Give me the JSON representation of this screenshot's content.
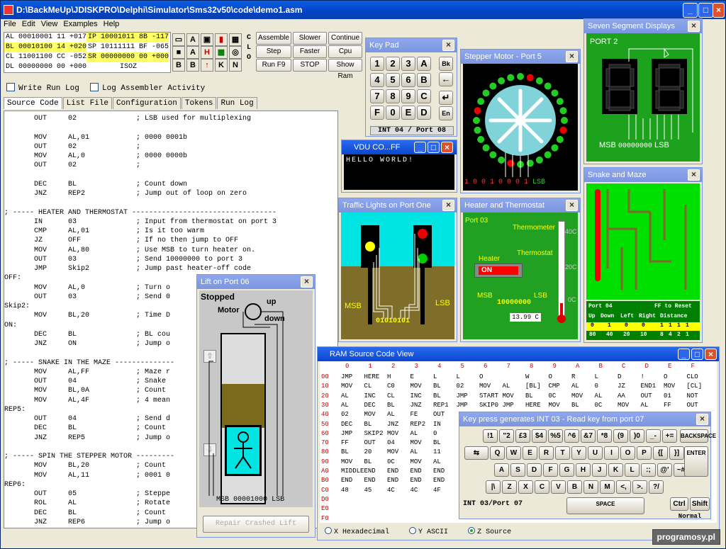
{
  "main": {
    "title": "D:\\BackMeUp\\JDISKPRO\\Delphi\\Simulator\\Sms32v50\\code\\demo1.asm"
  },
  "menu": [
    "File",
    "Edit",
    "View",
    "Examples",
    "Help"
  ],
  "registers": [
    [
      "AL 00010001 11 +017",
      "IP 10001011 8B -117"
    ],
    [
      "BL 00010100 14 +020",
      "SP 10111111 BF -065"
    ],
    [
      "CL 11001100 CC -052",
      "SR 00000000 00 +000"
    ],
    [
      "DL 00000000 00 +000",
      "ISOZ"
    ]
  ],
  "clo": [
    "C",
    "L",
    "O"
  ],
  "buttons": {
    "assemble": "Assemble",
    "slower": "Slower",
    "continue": "Continue",
    "step": "Step",
    "faster": "Faster",
    "cpu_reset": "Cpu Reset",
    "run": "Run F9",
    "stop": "STOP",
    "show_ram": "Show Ram"
  },
  "checks": {
    "write_log": "Write Run Log",
    "asm_log": "Log Assembler Activity"
  },
  "tabs": [
    "Source Code",
    "List File",
    "Configuration",
    "Tokens",
    "Run Log"
  ],
  "code": [
    "       OUT     02              ; LSB used for multiplexing",
    "",
    "       MOV     AL,01           ; 0000 0001b",
    "       OUT     02              ;",
    "       MOV     AL,0            ; 0000 0000b",
    "       OUT     02              ;",
    "",
    "       DEC     BL              ; Count down",
    "       JNZ     REP2            ; Jump out of loop on zero",
    "",
    "; ----- HEATER AND THERMOSTAT ----------------------------------",
    "       IN      03              ; Input from thermostat on port 3",
    "       CMP     AL,01           ; Is it too warm",
    "       JZ      OFF             ; If no then jump to OFF",
    "       MOV     AL,80           ; Use MSB to turn heater on.",
    "       OUT     03              ; Send 10000000 to port 3",
    "       JMP     Skip2           ; Jump past heater-off code",
    "OFF:",
    "       MOV     AL,0            ; Turn o",
    "       OUT     03              ; Send 0",
    "Skip2:",
    "       MOV     BL,20           ; Time D",
    "ON:",
    "       DEC     BL              ; BL cou",
    "       JNZ     ON              ; Jump o",
    "",
    "; ----- SNAKE IN THE MAZE --------------",
    "       MOV     AL,FF           ; Maze r",
    "       OUT     04              ; Snake",
    "       MOV     BL,0A           ; Count",
    "       MOV     AL,4F           ; 4 mean",
    "REP5:",
    "       OUT     04              ; Send d",
    "       DEC     BL              ; Count",
    "       JNZ     REP5            ; Jump o",
    "",
    "; ----- SPIN THE STEPPER MOTOR ---------",
    "       MOV     BL,20           ; Count",
    "       MOV     AL,11           ; 0001 0",
    "REP6:",
    "       OUT     05              ; Steppe",
    "       ROL     AL              ; Rotate",
    "       DEC     BL              ; Count",
    "       JNZ     REP6            ; Jump o"
  ],
  "keypad": {
    "title": "Key Pad",
    "keys": [
      "1",
      "2",
      "3",
      "A",
      "4",
      "5",
      "6",
      "B",
      "7",
      "8",
      "9",
      "C",
      "F",
      "0",
      "E",
      "D"
    ],
    "side": [
      "Bk",
      "←",
      "↵",
      "En"
    ],
    "footer": "INT 04 / Port 08"
  },
  "stepper": {
    "title": "Stepper Motor - Port 5",
    "bits": "1 0 0 1 0 0 0 1",
    "lsb": "LSB"
  },
  "sevenseg": {
    "title": "Seven Segment Displays",
    "port": "PORT  2",
    "msb": "MSB",
    "bits": "00000000",
    "lsb": "LSB"
  },
  "vdu": {
    "title": "VDU CO...FF",
    "text": "HELLO WORLD!"
  },
  "traffic": {
    "title": "Traffic Lights on Port One",
    "msb": "MSB",
    "lsb": "LSB",
    "bits": "01010101"
  },
  "heater": {
    "title": "Heater and Thermostat",
    "port": "Port 03",
    "thermometer": "Thermometer",
    "thermostat": "Thermostat",
    "heater": "Heater",
    "on": "ON",
    "msb": "MSB",
    "lsb": "LSB",
    "bits": "10000000",
    "temp": "13.99 C",
    "t40": "40C",
    "t20": "20C",
    "t0": "0C"
  },
  "snake": {
    "title": "Snake and Maze",
    "port": "Port 04",
    "reset": "FF to Reset",
    "headers": [
      "Up",
      "Down",
      "Left",
      "Right",
      "Distance"
    ],
    "bits": [
      "0",
      "1",
      "0",
      "0",
      "1",
      "1",
      "1",
      "1"
    ],
    "weights": [
      "80",
      "40",
      "20",
      "10",
      "8",
      "4",
      "2",
      "1"
    ]
  },
  "lift": {
    "title": "Lift on Port 06",
    "status": "Stopped",
    "motor": "Motor",
    "up": "up",
    "down": "down",
    "msb": "MSB",
    "bits": "00001000",
    "lsb": "LSB",
    "repair": "Repair Crashed Lift"
  },
  "ram": {
    "title": "RAM Source Code View",
    "cols": [
      "0",
      "1",
      "2",
      "3",
      "4",
      "5",
      "6",
      "7",
      "8",
      "9",
      "A",
      "B",
      "C",
      "D",
      "E",
      "F"
    ],
    "rows": [
      [
        "00",
        [
          "JMP",
          "HERE",
          "H",
          "E",
          "L",
          "L",
          "O",
          "",
          "W",
          "O",
          "R",
          "L",
          "D",
          "!",
          "O",
          "CLO"
        ]
      ],
      [
        "10",
        [
          "MOV",
          "CL",
          "C0",
          "MOV",
          "BL",
          "02",
          "MOV",
          "AL",
          "[BL]",
          "CMP",
          "AL",
          "0",
          "JZ",
          "END1",
          "MOV",
          "[CL]"
        ]
      ],
      [
        "20",
        [
          "AL",
          "INC",
          "CL",
          "INC",
          "BL",
          "JMP",
          "START",
          "MOV",
          "BL",
          "0C",
          "MOV",
          "AL",
          "AA",
          "OUT",
          "01",
          "NOT"
        ]
      ],
      [
        "30",
        [
          "AL",
          "DEC",
          "BL",
          "JNZ",
          "REP1",
          "JMP",
          "SKIP0",
          "JMP",
          "HERE",
          "MOV",
          "BL",
          "0C",
          "MOV",
          "AL",
          "FF",
          "OUT"
        ]
      ],
      [
        "40",
        [
          "02",
          "MOV",
          "AL",
          "FE",
          "OUT",
          "",
          "",
          "",
          "",
          "",
          "",
          "",
          "",
          "",
          "",
          ""
        ]
      ],
      [
        "50",
        [
          "DEC",
          "BL",
          "JNZ",
          "REP2",
          "IN",
          "",
          "",
          "",
          "",
          "",
          "",
          "",
          "",
          "",
          "",
          ""
        ]
      ],
      [
        "60",
        [
          "JMP",
          "SKIP2",
          "MOV",
          "AL",
          "0",
          "",
          "",
          "",
          "",
          "",
          "",
          "",
          "",
          "",
          "",
          ""
        ]
      ],
      [
        "70",
        [
          "FF",
          "OUT",
          "04",
          "MOV",
          "BL",
          "",
          "",
          "",
          "",
          "",
          "",
          "",
          "",
          "",
          "",
          ""
        ]
      ],
      [
        "80",
        [
          "BL",
          "20",
          "MOV",
          "AL",
          "11",
          "",
          "",
          "",
          "",
          "",
          "",
          "",
          "",
          "",
          "",
          ""
        ]
      ],
      [
        "90",
        [
          "MOV",
          "BL",
          "0C",
          "MOV",
          "AL",
          "",
          "",
          "",
          "",
          "",
          "",
          "",
          "",
          "",
          "",
          ""
        ]
      ],
      [
        "A0",
        [
          "MIDDLE",
          "END",
          "END",
          "END",
          "END",
          "",
          "",
          "",
          "",
          "",
          "",
          "",
          "",
          "",
          "",
          ""
        ]
      ],
      [
        "B0",
        [
          "END",
          "END",
          "END",
          "END",
          "END",
          "",
          "",
          "",
          "",
          "",
          "",
          "",
          "",
          "",
          "",
          ""
        ]
      ],
      [
        "C0",
        [
          "48",
          "45",
          "4C",
          "4C",
          "4F",
          "",
          "",
          "",
          "",
          "",
          "",
          "",
          "",
          "",
          "",
          ""
        ]
      ],
      [
        "D0",
        []
      ],
      [
        "E0",
        []
      ],
      [
        "F0",
        []
      ]
    ],
    "modes": [
      "X Hexadecimal",
      "Y ASCII",
      "Z Source"
    ]
  },
  "keyboard": {
    "title": "Key press generates INT 03 - Read key from port 07",
    "footer": "INT 03/Port 07",
    "ctrl": "Ctrl",
    "shift": "Shift",
    "normal": "Normal",
    "space": "SPACE",
    "backspace": "BACKSPACE",
    "enter": "ENTER"
  },
  "watermark": "programosy.pl"
}
